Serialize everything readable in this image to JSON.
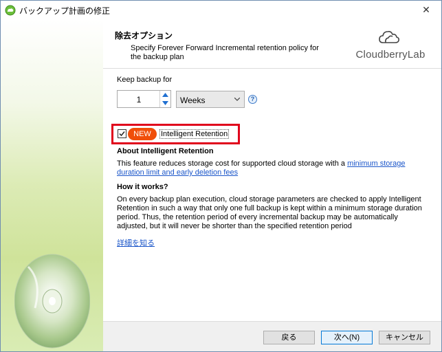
{
  "window": {
    "title": "バックアップ計画の修正",
    "close_glyph": "✕"
  },
  "header": {
    "title": "除去オプション",
    "description": "Specify Forever Forward Incremental retention policy for the backup plan",
    "logo_text": "CloudberryLab"
  },
  "keep_backup": {
    "label": "Keep backup for",
    "value": "1",
    "unit": "Weeks",
    "help_glyph": "?"
  },
  "intelligent_retention": {
    "checked": true,
    "badge": "NEW",
    "label": "Intelligent Retention"
  },
  "about": {
    "title": "About Intelligent Retention",
    "text_before": "This feature reduces storage cost for supported cloud storage with a ",
    "link": "minimum storage duration limit and early deletion fees"
  },
  "how": {
    "title": "How it works?",
    "text": "On every backup plan execution, cloud storage parameters are checked to apply Intelligent Retention in such a way that only one full backup is kept within a minimum storage duration period. Thus, the retention period of every incremental backup may be automatically adjusted, but it will never be shorter than the specified retention period",
    "more_link": "詳細を知る"
  },
  "footer": {
    "back": "戻る",
    "next": "次へ(N)",
    "cancel": "キャンセル"
  },
  "colors": {
    "accent": "#0078d7",
    "highlight_border": "#e0001b",
    "new_badge": "#f04e0a",
    "link": "#1a55c9"
  }
}
